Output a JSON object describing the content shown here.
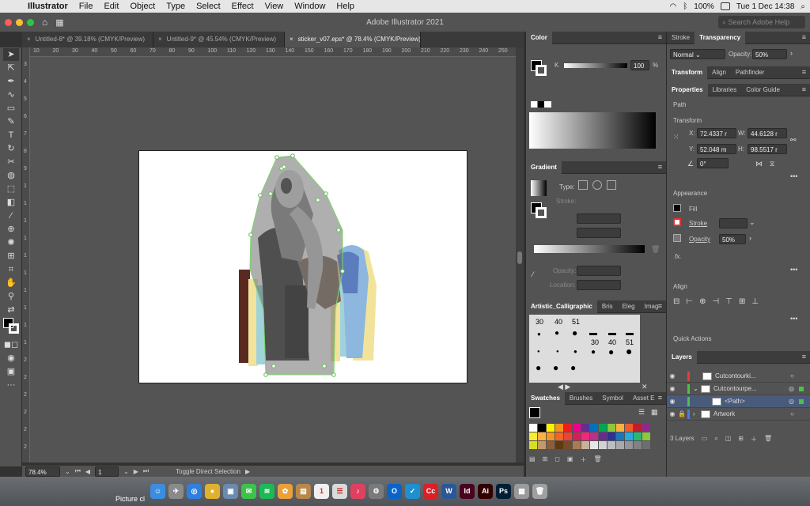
{
  "menubar": {
    "app": "Illustrator",
    "items": [
      "File",
      "Edit",
      "Object",
      "Type",
      "Select",
      "Effect",
      "View",
      "Window",
      "Help"
    ],
    "battery": "100%",
    "clock": "Tue 1 Dec  14:38"
  },
  "appbar": {
    "title": "Adobe Illustrator 2021",
    "search_placeholder": "Search Adobe Help"
  },
  "doc_tabs": [
    {
      "label": "Untitled-8* @ 39.18% (CMYK/Preview)"
    },
    {
      "label": "Untitled-9* @ 45.54% (CMYK/Preview)"
    },
    {
      "label": "sticker_v07.eps* @ 78.4% (CMYK/Preview)"
    }
  ],
  "ruler_ticks": [
    "10",
    "20",
    "30",
    "40",
    "50",
    "60",
    "70",
    "80",
    "90",
    "100",
    "110",
    "120",
    "130",
    "140",
    "150",
    "160",
    "170",
    "180",
    "190",
    "200",
    "210",
    "220",
    "230",
    "240",
    "250"
  ],
  "ruler_v_ticks": [
    "3",
    "4",
    "5",
    "6",
    "7",
    "8",
    "9",
    "1",
    "1",
    "1",
    "1",
    "1",
    "1",
    "1",
    "1",
    "1",
    "1",
    "2",
    "2",
    "2",
    "2",
    "2",
    "2"
  ],
  "status": {
    "zoom": "78.4%",
    "artboard": "1",
    "tool_hint": "Toggle Direct Selection"
  },
  "color_panel": {
    "title": "Color",
    "channel": "K",
    "value": "100",
    "unit": "%"
  },
  "gradient_panel": {
    "title": "Gradient",
    "type_label": "Type:",
    "stroke_label": "Stroke:",
    "opacity_label": "Opacity:",
    "location_label": "Location:"
  },
  "brushes_panel": {
    "tabs": [
      "Artistic_Calligraphic",
      "Bris",
      "Eleg",
      "Imag"
    ],
    "top_values": [
      "30",
      "40",
      "51"
    ],
    "mid_values": [
      "30",
      "40",
      "51"
    ]
  },
  "swatches_panel": {
    "tabs": [
      "Swatches",
      "Brushes",
      "Symbol",
      "Asset E"
    ],
    "colors": [
      "#ffffff",
      "#000000",
      "#fff200",
      "#f7941d",
      "#ed1c24",
      "#ec008c",
      "#662d91",
      "#0072bc",
      "#00a651",
      "#8dc63f",
      "#fbb040",
      "#f15a29",
      "#be1e2d",
      "#92278f",
      "#f9ed32",
      "#fbb040",
      "#f7941d",
      "#f26522",
      "#ef4136",
      "#da1c5c",
      "#ee2a7b",
      "#bb2f8d",
      "#662d91",
      "#2e3192",
      "#1b75bc",
      "#27aae1",
      "#2bb673",
      "#8dc63f",
      "#d7df23",
      "#c49a6c",
      "#8b5e3c",
      "#603913",
      "#754c29",
      "#a97c50",
      "#c7b299",
      "#e6e7e8",
      "#d1d3d4",
      "#bcbec0",
      "#a7a9ac",
      "#939598",
      "#808285",
      "#6d6e71",
      "#000000",
      "#231f20",
      "#414042",
      "#58595b",
      "#f9ed32",
      "#fbb040",
      "#ef4136",
      "#00aeef",
      "#2bb673",
      "#662d91",
      "#ffffff",
      "#000000"
    ]
  },
  "transparency_panel": {
    "tabs": [
      "Stroke",
      "Transparency"
    ],
    "mode": "Normal",
    "opacity_label": "Opacity:",
    "opacity": "50%"
  },
  "properties_panel": {
    "top_tabs": [
      "Transform",
      "Align",
      "Pathfinder"
    ],
    "tabs": [
      "Properties",
      "Libraries",
      "Color Guide"
    ],
    "object_type": "Path",
    "transform_title": "Transform",
    "x_label": "X:",
    "x": "72.4337 r",
    "y_label": "Y:",
    "y": "52.048 m",
    "w_label": "W:",
    "w": "44.6128 r",
    "h_label": "H:",
    "h": "98.5517 r",
    "angle": "0°",
    "appearance_title": "Appearance",
    "fill_label": "Fill",
    "stroke_label": "Stroke",
    "opacity_label": "Opacity",
    "opacity": "50%",
    "fx": "fx.",
    "align_title": "Align",
    "quick_actions": "Quick Actions"
  },
  "layers_panel": {
    "title": "Layers",
    "rows": [
      {
        "name": "Cutcontourki...",
        "color": "#e0403a"
      },
      {
        "name": "Cutcontourpe...",
        "color": "#4cc14c"
      },
      {
        "name": "<Path>",
        "color": "#4cc14c"
      },
      {
        "name": "Artwork",
        "color": "#4a7de0"
      }
    ],
    "count": "3 Layers"
  },
  "dock": {
    "label": "Picture cl",
    "icons": [
      {
        "name": "finder-icon",
        "color": "#3b8de0",
        "glyph": "☺"
      },
      {
        "name": "launchpad-icon",
        "color": "#8a8a8a",
        "glyph": "✈"
      },
      {
        "name": "safari-icon",
        "color": "#2f7fe0",
        "glyph": "◎"
      },
      {
        "name": "chrome-icon",
        "color": "#e0b030",
        "glyph": "●"
      },
      {
        "name": "preview-icon",
        "color": "#6a8ab0",
        "glyph": "▣"
      },
      {
        "name": "messages-icon",
        "color": "#3cc44a",
        "glyph": "✉"
      },
      {
        "name": "spotify-icon",
        "color": "#1db954",
        "glyph": "≋"
      },
      {
        "name": "photos-icon",
        "color": "#e9a13b",
        "glyph": "✿"
      },
      {
        "name": "notes-icon",
        "color": "#b8884a",
        "glyph": "▤"
      },
      {
        "name": "calendar-icon",
        "color": "#f0f0f0",
        "glyph": "1"
      },
      {
        "name": "reminders-icon",
        "color": "#dadada",
        "glyph": "☰"
      },
      {
        "name": "music-icon",
        "color": "#e04060",
        "glyph": "♪"
      },
      {
        "name": "settings-icon",
        "color": "#7a7a7a",
        "glyph": "⚙"
      },
      {
        "name": "outlook-icon",
        "color": "#0a64c8",
        "glyph": "O"
      },
      {
        "name": "teams-icon",
        "color": "#1e90d0",
        "glyph": "✓"
      },
      {
        "name": "creative-cloud-icon",
        "color": "#da1f26",
        "glyph": "Cc"
      },
      {
        "name": "word-icon",
        "color": "#2b579a",
        "glyph": "W"
      },
      {
        "name": "indesign-icon",
        "color": "#49021f",
        "glyph": "Id"
      },
      {
        "name": "illustrator-icon",
        "color": "#330000",
        "glyph": "Ai"
      },
      {
        "name": "photoshop-icon",
        "color": "#001e36",
        "glyph": "Ps"
      },
      {
        "name": "screenshot-icon",
        "color": "#9a9a9a",
        "glyph": "▦"
      },
      {
        "name": "trash-icon",
        "color": "#a0a0a0",
        "glyph": "🗑"
      }
    ]
  }
}
